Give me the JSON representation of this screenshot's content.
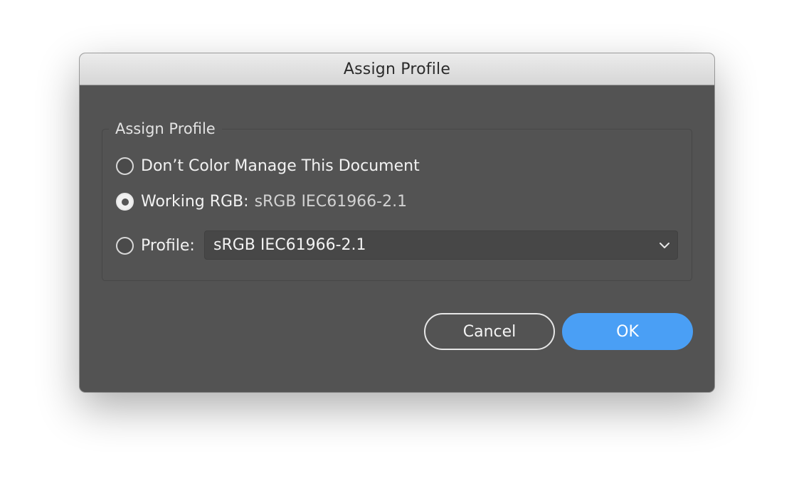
{
  "window": {
    "title": "Assign Profile"
  },
  "group": {
    "legend": "Assign Profile"
  },
  "options": [
    {
      "label": "Don’t Color Manage This Document",
      "checked": false
    },
    {
      "label": "Working RGB:",
      "value": "sRGB IEC61966-2.1",
      "checked": true
    },
    {
      "label": "Profile:",
      "checked": false
    }
  ],
  "profile_select": {
    "selected": "sRGB IEC61966-2.1",
    "icon": "chevron-down-icon"
  },
  "buttons": {
    "cancel": "Cancel",
    "ok": "OK"
  },
  "colors": {
    "dialog_bg": "#535353",
    "accent": "#4a9ff5"
  }
}
